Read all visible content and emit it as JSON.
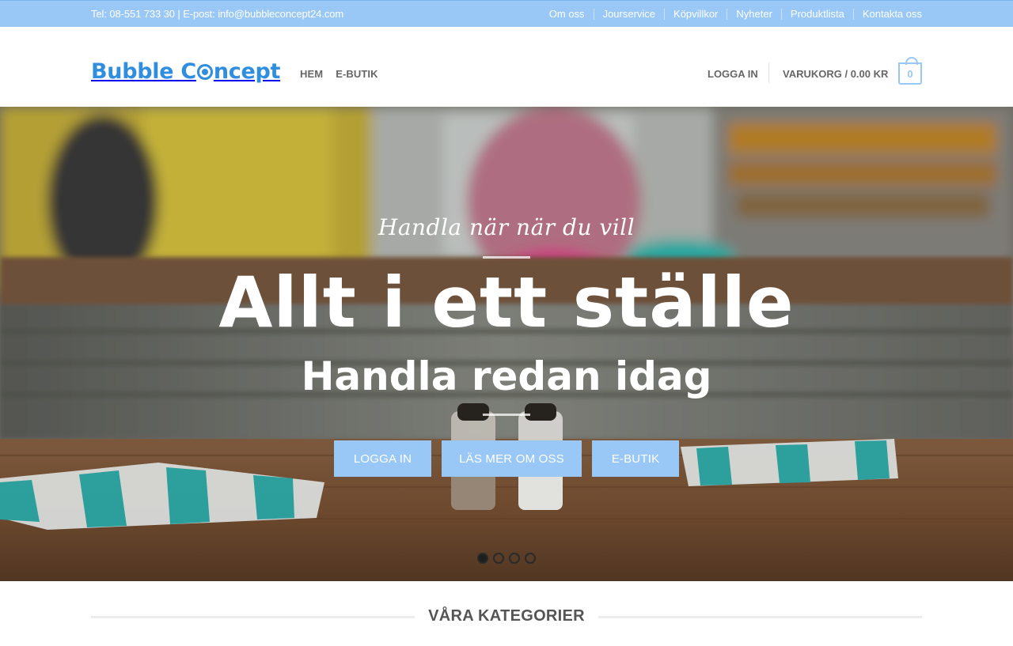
{
  "topbar": {
    "contact": "Tel: 08-551 733 30 | E-post: info@bubbleconcept24.com",
    "links": [
      "Om oss",
      "Jourservice",
      "Köpvillkor",
      "Nyheter",
      "Produktlista",
      "Kontakta oss"
    ]
  },
  "header": {
    "logo_part1": "Bubble C",
    "logo_part2": "ncept",
    "nav": [
      "HEM",
      "E-BUTIK"
    ],
    "login": "LOGGA IN",
    "cart_label": "VARUKORG / 0.00 KR",
    "cart_count": "0"
  },
  "hero": {
    "script_text": "Handla när när du vill",
    "headline": "Allt i ett ställe",
    "subheadline": "Handla redan idag",
    "buttons": [
      "LOGGA IN",
      "LÄS MER OM OSS",
      "E-BUTIK"
    ],
    "slide_count": 4,
    "active_slide": 1
  },
  "section": {
    "title": "VÅRA KATEGORIER"
  },
  "colors": {
    "accent": "#99c8f7",
    "logo": "#2f8ee0"
  }
}
